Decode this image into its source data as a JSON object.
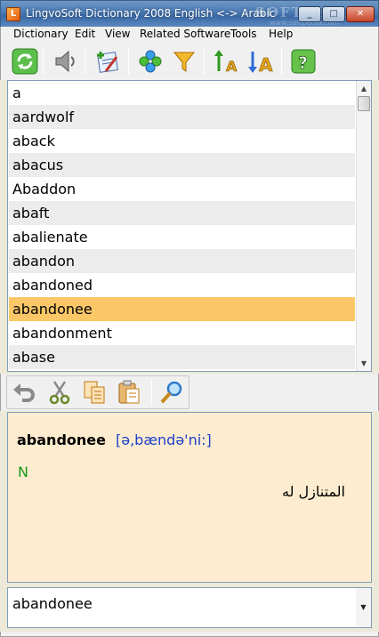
{
  "window": {
    "title": "LingvoSoft Dictionary 2008 English <-> Arabic",
    "watermark": "SOFTPEDIA",
    "watermark_sub": "www.softpedia.com",
    "controls": {
      "minimize": "_",
      "maximize": "□",
      "close": "✕"
    }
  },
  "menu": [
    "Dictionary",
    "Edit",
    "View",
    "Related Software",
    "Tools",
    "Help"
  ],
  "toolbar": [
    {
      "icon": "refresh-icon"
    },
    {
      "icon": "speaker-icon"
    },
    {
      "icon": "add-word-icon"
    },
    {
      "icon": "flower-icon"
    },
    {
      "icon": "filter-icon"
    },
    {
      "icon": "sort-ascending-icon"
    },
    {
      "icon": "sort-descending-icon"
    },
    {
      "icon": "help-icon"
    }
  ],
  "word_list": {
    "items": [
      "a",
      "aardwolf",
      "aback",
      "abacus",
      "Abaddon",
      "abaft",
      "abalienate",
      "abandon",
      "abandoned",
      "abandonee",
      "abandonment",
      "abase"
    ],
    "selected_index": 9
  },
  "edit_toolbar": [
    {
      "icon": "undo-icon"
    },
    {
      "icon": "cut-icon"
    },
    {
      "icon": "copy-icon"
    },
    {
      "icon": "paste-icon"
    },
    {
      "icon": "search-icon"
    }
  ],
  "article": {
    "headword": "abandonee",
    "transcription": "[ə,bændə'ni:]",
    "part_of_speech": "N",
    "translation": "المتنازل له"
  },
  "search": {
    "value": "abandonee"
  },
  "colors": {
    "selected_row": "#fcc766",
    "alt_row": "#ececec",
    "article_bg": "#fdeccf",
    "transcription": "#1c3fcb",
    "part_of_speech": "#1a9a1a"
  }
}
